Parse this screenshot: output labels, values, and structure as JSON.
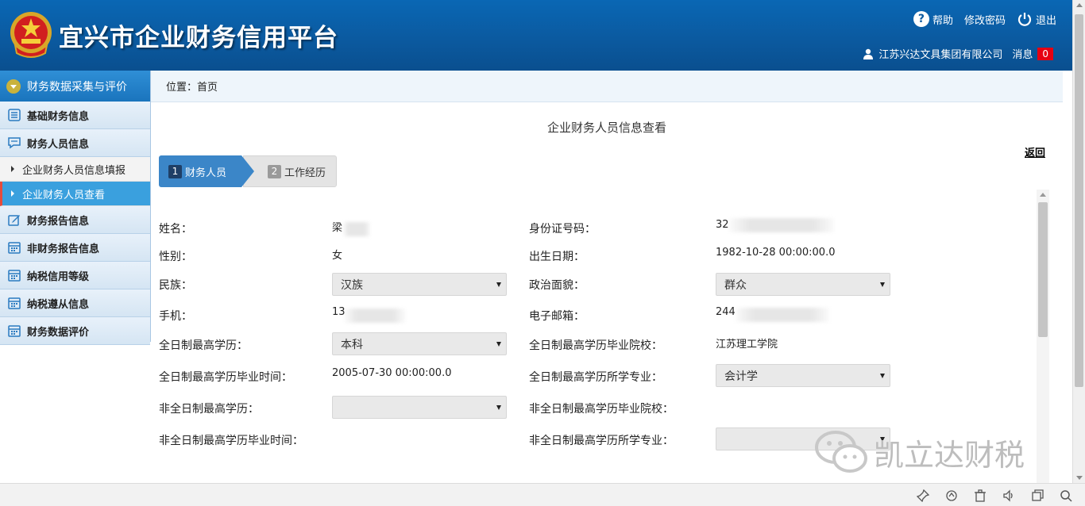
{
  "header": {
    "title": "宜兴市企业财务信用平台",
    "help": "帮助",
    "change_password": "修改密码",
    "logout": "退出",
    "company": "江苏兴达文具集团有限公司",
    "message_label": "消息",
    "message_count": "0"
  },
  "sidebar": {
    "header": "财务数据采集与评价",
    "items": [
      {
        "label": "基础财务信息",
        "icon": "list-icon"
      },
      {
        "label": "财务人员信息",
        "icon": "chat-icon"
      },
      {
        "label": "企业财务人员信息填报",
        "sub": true
      },
      {
        "label": "企业财务人员查看",
        "sub": true,
        "active": true
      },
      {
        "label": "财务报告信息",
        "icon": "edit-icon"
      },
      {
        "label": "非财务报告信息",
        "icon": "calendar-icon"
      },
      {
        "label": "纳税信用等级",
        "icon": "calendar-icon"
      },
      {
        "label": "纳税遵从信息",
        "icon": "calendar-icon"
      },
      {
        "label": "财务数据评价",
        "icon": "calendar-icon"
      }
    ]
  },
  "breadcrumb": "位置：首页",
  "page_title": "企业财务人员信息查看",
  "back_label": "返回",
  "steps": [
    {
      "num": "1",
      "label": "财务人员",
      "active": true
    },
    {
      "num": "2",
      "label": "工作经历",
      "active": false
    }
  ],
  "form": {
    "name_label": "姓名：",
    "name_value": "梁",
    "id_label": "身份证号码：",
    "id_value": "32",
    "gender_label": "性别：",
    "gender_value": "女",
    "birth_label": "出生日期：",
    "birth_value": "1982-10-28 00:00:00.0",
    "ethnic_label": "民族：",
    "ethnic_value": "汉族",
    "political_label": "政治面貌：",
    "political_value": "群众",
    "phone_label": "手机：",
    "phone_value": "13",
    "email_label": "电子邮箱：",
    "email_value": "244",
    "ft_edu_label": "全日制最高学历：",
    "ft_edu_value": "本科",
    "ft_school_label": "全日制最高学历毕业院校：",
    "ft_school_value": "江苏理工学院",
    "ft_grad_label": "全日制最高学历毕业时间：",
    "ft_grad_value": "2005-07-30 00:00:00.0",
    "ft_major_label": "全日制最高学历所学专业：",
    "ft_major_value": "会计学",
    "pt_edu_label": "非全日制最高学历：",
    "pt_edu_value": "",
    "pt_school_label": "非全日制最高学历毕业院校：",
    "pt_grad_label": "非全日制最高学历毕业时间：",
    "pt_major_label": "非全日制最高学历所学专业：",
    "pt_major_value": ""
  },
  "watermark": "凯立达财税",
  "colors": {
    "header_blue": "#0b5aa0",
    "step_active": "#3b86c8",
    "sidebar_active": "#3aa0de",
    "badge_red": "#e60012"
  }
}
